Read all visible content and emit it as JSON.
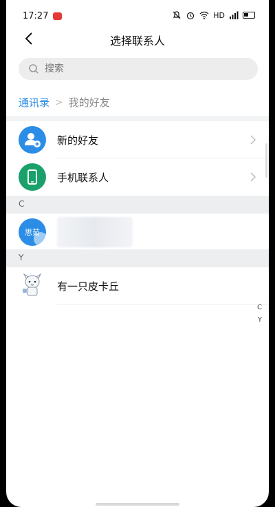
{
  "status": {
    "time": "17:27",
    "network": "HD"
  },
  "header": {
    "title": "选择联系人"
  },
  "search": {
    "placeholder": "搜索"
  },
  "breadcrumb": {
    "root": "通讯录",
    "current": "我的好友"
  },
  "top_items": [
    {
      "label": "新的好友",
      "icon": "add-user-icon",
      "color": "#2b8de6"
    },
    {
      "label": "手机联系人",
      "icon": "phone-icon",
      "color": "#1aa16b"
    }
  ],
  "sections": [
    {
      "letter": "C",
      "contacts": [
        {
          "avatar_text": "思茹",
          "name": ""
        }
      ]
    },
    {
      "letter": "Y",
      "contacts": [
        {
          "avatar_text": "",
          "name": "有一只皮卡丘"
        }
      ]
    }
  ],
  "index_letters": [
    "C",
    "Y"
  ]
}
